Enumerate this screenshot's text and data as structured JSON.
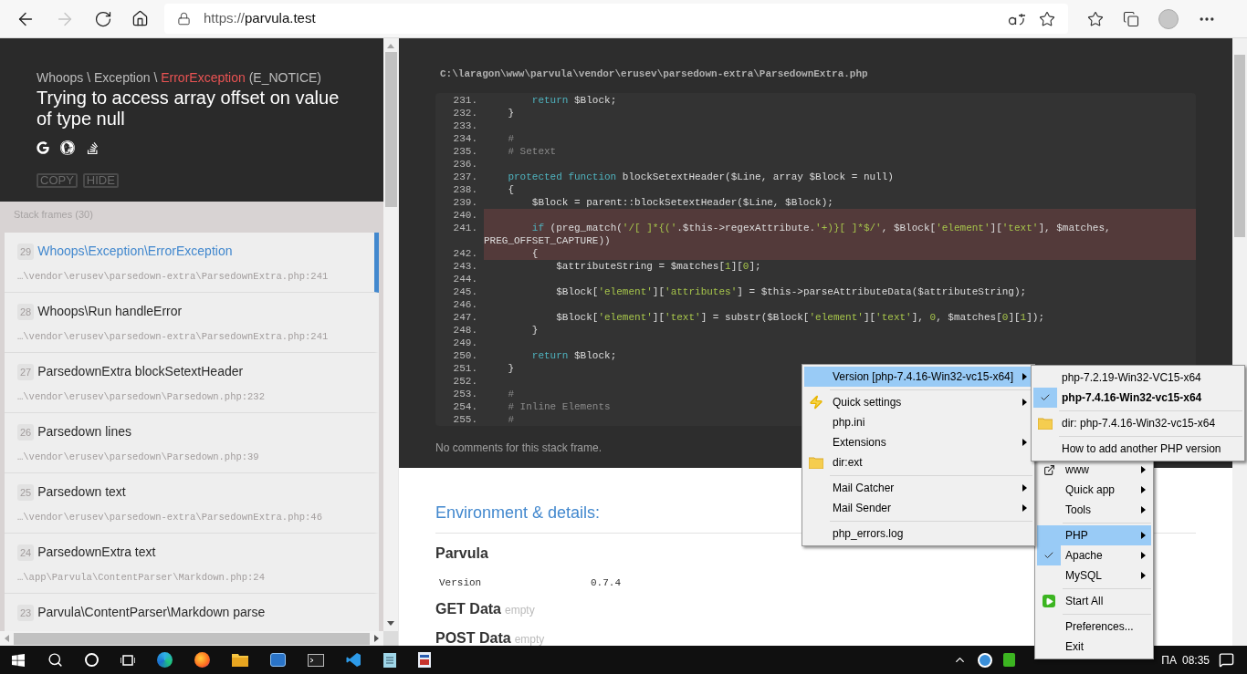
{
  "browser": {
    "url_scheme": "https://",
    "url_host": "parvula.test"
  },
  "error": {
    "breadcrumb": [
      {
        "kind": "namespace",
        "text": "Whoops \\ Exception \\ "
      },
      {
        "kind": "class",
        "text": "ErrorException"
      },
      {
        "kind": "code",
        "text": " (E_NOTICE)"
      }
    ],
    "message": "Trying to access array offset on value of type null",
    "buttons": [
      "COPY",
      "HIDE"
    ]
  },
  "stack": {
    "title": "Stack frames (30)",
    "frames": [
      {
        "number": "29",
        "name": "Whoops\\Exception\\ErrorException",
        "file": "…\\vendor\\erusev\\parsedown-extra\\ParsedownExtra.php:241",
        "selected": true
      },
      {
        "number": "28",
        "name": "Whoops\\Run handleError",
        "file": "…\\vendor\\erusev\\parsedown-extra\\ParsedownExtra.php:241",
        "selected": false
      },
      {
        "number": "27",
        "name": "ParsedownExtra blockSetextHeader",
        "file": "…\\vendor\\erusev\\parsedown\\Parsedown.php:232",
        "selected": false
      },
      {
        "number": "26",
        "name": "Parsedown lines",
        "file": "…\\vendor\\erusev\\parsedown\\Parsedown.php:39",
        "selected": false
      },
      {
        "number": "25",
        "name": "Parsedown text",
        "file": "…\\vendor\\erusev\\parsedown-extra\\ParsedownExtra.php:46",
        "selected": false
      },
      {
        "number": "24",
        "name": "ParsedownExtra text",
        "file": "…\\app\\Parvula\\ContentParser\\Markdown.php:24",
        "selected": false
      },
      {
        "number": "23",
        "name": "Parvula\\ContentParser\\Markdown parse",
        "selected": false
      }
    ]
  },
  "code": {
    "path": "C:\\laragon\\www\\parvula\\vendor\\erusev\\parsedown-extra\\ParsedownExtra.php",
    "lines": [
      {
        "number": "231.",
        "highlighted": false,
        "segments": [
          {
            "kind": "keyword",
            "text": "        return"
          },
          {
            "kind": "plain",
            "text": " $Block;"
          }
        ]
      },
      {
        "number": "232.",
        "highlighted": false,
        "segments": [
          {
            "kind": "plain",
            "text": "    }"
          }
        ]
      },
      {
        "number": "233.",
        "highlighted": false
      },
      {
        "number": "234.",
        "highlighted": false,
        "segments": [
          {
            "kind": "comment",
            "text": "    #"
          }
        ]
      },
      {
        "number": "235.",
        "highlighted": false,
        "segments": [
          {
            "kind": "comment",
            "text": "    # Setext"
          }
        ]
      },
      {
        "number": "236.",
        "highlighted": false
      },
      {
        "number": "237.",
        "highlighted": false,
        "segments": [
          {
            "kind": "keyword",
            "text": "    protected function"
          },
          {
            "kind": "plain",
            "text": " blockSetextHeader($Line, array $Block = null)"
          }
        ]
      },
      {
        "number": "238.",
        "highlighted": false,
        "segments": [
          {
            "kind": "plain",
            "text": "    {"
          }
        ]
      },
      {
        "number": "239.",
        "highlighted": false,
        "segments": [
          {
            "kind": "plain",
            "text": "        $Block = parent::blockSetextHeader($Line, $Block);"
          }
        ]
      },
      {
        "number": "240.",
        "highlighted": true
      },
      {
        "number": "241.",
        "highlighted": true,
        "segments": [
          {
            "kind": "keyword",
            "text": "        if"
          },
          {
            "kind": "plain",
            "text": " (preg_match("
          },
          {
            "kind": "string",
            "text": "'/[ ]*{('"
          },
          {
            "kind": "plain",
            "text": ".$this->regexAttribute."
          },
          {
            "kind": "string",
            "text": "'+)}[ ]*$/'"
          },
          {
            "kind": "plain",
            "text": ", $Block["
          },
          {
            "kind": "string",
            "text": "'element'"
          },
          {
            "kind": "plain",
            "text": "]["
          },
          {
            "kind": "string",
            "text": "'text'"
          },
          {
            "kind": "plain",
            "text": "], $matches,"
          }
        ]
      },
      {
        "highlighted": true,
        "segments": [
          {
            "kind": "plain",
            "text": "PREG_OFFSET_CAPTURE))"
          }
        ]
      },
      {
        "number": "242.",
        "highlighted": true,
        "segments": [
          {
            "kind": "plain",
            "text": "        {"
          }
        ]
      },
      {
        "number": "243.",
        "highlighted": false,
        "segments": [
          {
            "kind": "plain",
            "text": "            $attributeString = $matches["
          },
          {
            "kind": "string",
            "text": "1"
          },
          {
            "kind": "plain",
            "text": "]["
          },
          {
            "kind": "string",
            "text": "0"
          },
          {
            "kind": "plain",
            "text": "];"
          }
        ]
      },
      {
        "number": "244.",
        "highlighted": false
      },
      {
        "number": "245.",
        "highlighted": false,
        "segments": [
          {
            "kind": "plain",
            "text": "            $Block["
          },
          {
            "kind": "string",
            "text": "'element'"
          },
          {
            "kind": "plain",
            "text": "]["
          },
          {
            "kind": "string",
            "text": "'attributes'"
          },
          {
            "kind": "plain",
            "text": "] = $this->parseAttributeData($attributeString);"
          }
        ]
      },
      {
        "number": "246.",
        "highlighted": false
      },
      {
        "number": "247.",
        "highlighted": false,
        "segments": [
          {
            "kind": "plain",
            "text": "            $Block["
          },
          {
            "kind": "string",
            "text": "'element'"
          },
          {
            "kind": "plain",
            "text": "]["
          },
          {
            "kind": "string",
            "text": "'text'"
          },
          {
            "kind": "plain",
            "text": "] = substr($Block["
          },
          {
            "kind": "string",
            "text": "'element'"
          },
          {
            "kind": "plain",
            "text": "]["
          },
          {
            "kind": "string",
            "text": "'text'"
          },
          {
            "kind": "plain",
            "text": "], "
          },
          {
            "kind": "string",
            "text": "0"
          },
          {
            "kind": "plain",
            "text": ", $matches["
          },
          {
            "kind": "string",
            "text": "0"
          },
          {
            "kind": "plain",
            "text": "]["
          },
          {
            "kind": "string",
            "text": "1"
          },
          {
            "kind": "plain",
            "text": "]);"
          }
        ]
      },
      {
        "number": "248.",
        "highlighted": false,
        "segments": [
          {
            "kind": "plain",
            "text": "        }"
          }
        ]
      },
      {
        "number": "249.",
        "highlighted": false
      },
      {
        "number": "250.",
        "highlighted": false,
        "segments": [
          {
            "kind": "keyword",
            "text": "        return"
          },
          {
            "kind": "plain",
            "text": " $Block;"
          }
        ]
      },
      {
        "number": "251.",
        "highlighted": false,
        "segments": [
          {
            "kind": "plain",
            "text": "    }"
          }
        ]
      },
      {
        "number": "252.",
        "highlighted": false
      },
      {
        "number": "253.",
        "highlighted": false,
        "segments": [
          {
            "kind": "comment",
            "text": "    #"
          }
        ]
      },
      {
        "number": "254.",
        "highlighted": false,
        "segments": [
          {
            "kind": "comment",
            "text": "    # Inline Elements"
          }
        ]
      },
      {
        "number": "255.",
        "highlighted": false,
        "segments": [
          {
            "kind": "comment",
            "text": "    #"
          }
        ]
      }
    ]
  },
  "comments": "No comments for this stack frame.",
  "environment": {
    "title": "Environment & details:",
    "sections": [
      {
        "title": "Parvula",
        "rows": [
          {
            "key": "Version",
            "value": "0.7.4"
          }
        ]
      },
      {
        "title": "GET Data",
        "note": "empty"
      },
      {
        "title": "POST Data",
        "note": "empty"
      }
    ]
  },
  "menus": {
    "php": [
      {
        "kind": "item",
        "label": "Version [php-7.4.16-Win32-vc15-x64]",
        "submenu": true,
        "highlighted": true,
        "checked": false
      },
      {
        "kind": "separator"
      },
      {
        "kind": "quick",
        "label": "Quick settings",
        "submenu": true,
        "highlighted": false,
        "checked": false
      },
      {
        "kind": "item",
        "label": "php.ini",
        "submenu": false,
        "highlighted": false,
        "checked": false
      },
      {
        "kind": "item",
        "label": "Extensions",
        "submenu": true,
        "highlighted": false,
        "checked": false
      },
      {
        "kind": "folder",
        "label": "dir:ext",
        "submenu": false,
        "highlighted": false,
        "checked": false
      },
      {
        "kind": "separator"
      },
      {
        "kind": "item",
        "label": "Mail Catcher",
        "submenu": true,
        "highlighted": false,
        "checked": false
      },
      {
        "kind": "item",
        "label": "Mail Sender",
        "submenu": true,
        "highlighted": false,
        "checked": false
      },
      {
        "kind": "separator"
      },
      {
        "kind": "item",
        "label": "php_errors.log",
        "submenu": false,
        "highlighted": false,
        "checked": false
      }
    ],
    "version": [
      {
        "kind": "item",
        "label": "php-7.2.19-Win32-VC15-x64",
        "submenu": false,
        "highlighted": false,
        "checked": false,
        "bold": false
      },
      {
        "kind": "item",
        "label": "php-7.4.16-Win32-vc15-x64",
        "submenu": false,
        "highlighted": false,
        "checked": true,
        "bold": true
      },
      {
        "kind": "separator"
      },
      {
        "kind": "folder",
        "label": "dir: php-7.4.16-Win32-vc15-x64",
        "submenu": false,
        "highlighted": false,
        "checked": false,
        "bold": false
      },
      {
        "kind": "separator"
      },
      {
        "kind": "item",
        "label": "How to add another PHP version",
        "submenu": false,
        "highlighted": false,
        "checked": false,
        "bold": false
      }
    ],
    "main": [
      {
        "kind": "link",
        "label": "www",
        "submenu": true,
        "highlighted": false,
        "checked": false
      },
      {
        "kind": "item",
        "label": "Quick app",
        "submenu": true,
        "highlighted": false,
        "checked": false
      },
      {
        "kind": "item",
        "label": "Tools",
        "submenu": true,
        "highlighted": false,
        "checked": false
      },
      {
        "kind": "separator"
      },
      {
        "kind": "item",
        "label": "PHP",
        "submenu": true,
        "highlighted": true,
        "checked": false
      },
      {
        "kind": "item",
        "label": "Apache",
        "submenu": true,
        "highlighted": false,
        "checked": true
      },
      {
        "kind": "item",
        "label": "MySQL",
        "submenu": true,
        "highlighted": false,
        "checked": false
      },
      {
        "kind": "separator"
      },
      {
        "kind": "start",
        "label": "Start All",
        "submenu": false,
        "highlighted": false,
        "checked": false
      },
      {
        "kind": "separator"
      },
      {
        "kind": "item",
        "label": "Preferences...",
        "submenu": false,
        "highlighted": false,
        "checked": false
      },
      {
        "kind": "item",
        "label": "Exit",
        "submenu": false,
        "highlighted": false,
        "checked": false
      }
    ]
  },
  "taskbar": {
    "language": "ΠΑ",
    "time": "08:35"
  }
}
